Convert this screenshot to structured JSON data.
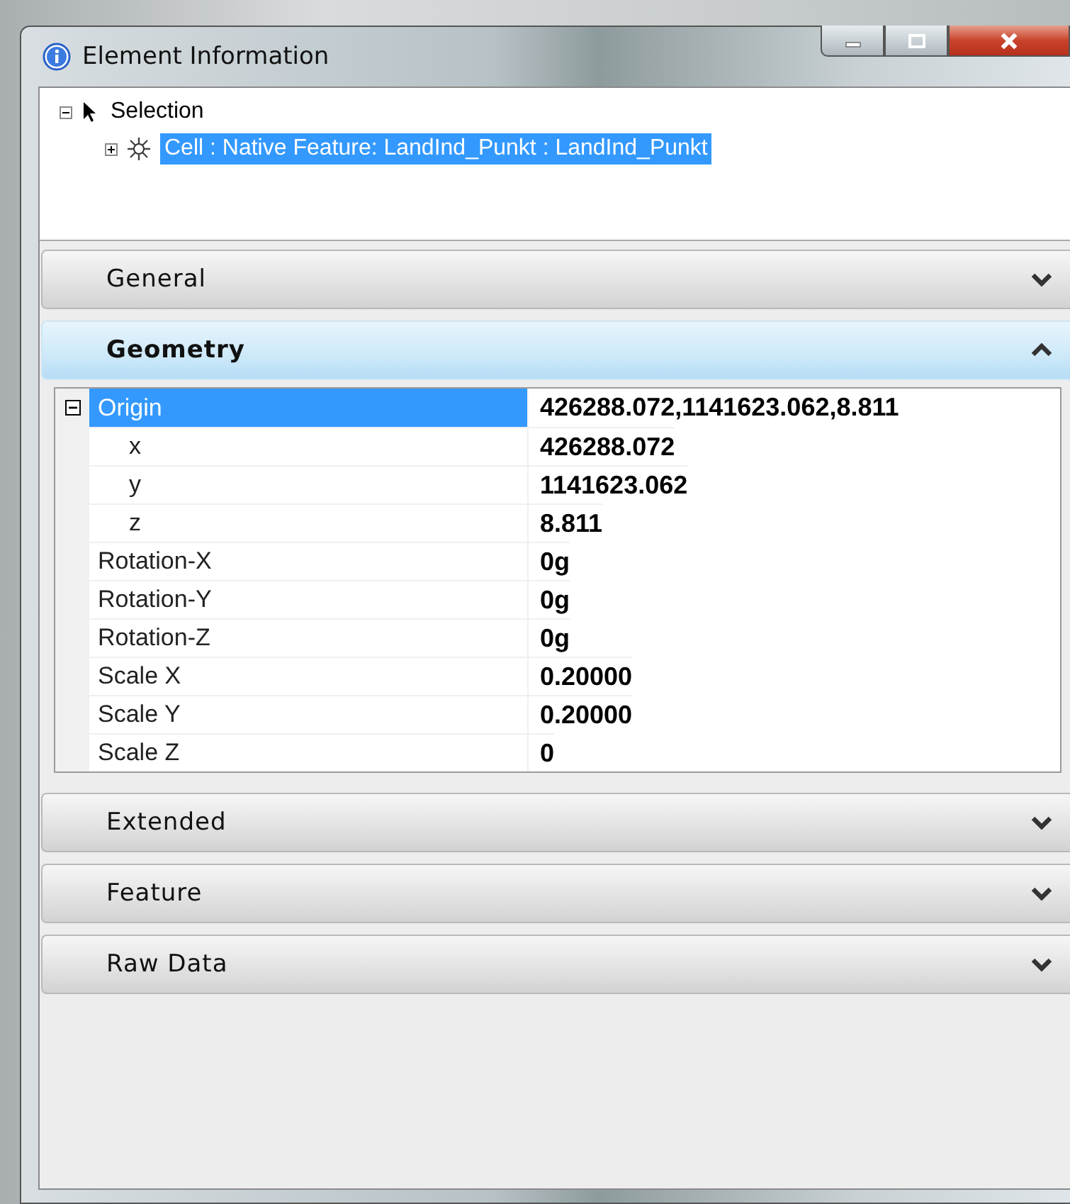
{
  "window": {
    "title": "Element Information"
  },
  "tree": [
    {
      "label": "Selection",
      "kind": "pointer",
      "expanded": true,
      "selected": false,
      "children": [
        {
          "label": "Cell : Native Feature: LandInd_Punkt : LandInd_Punkt",
          "kind": "cell",
          "expanded": false,
          "selected": true
        }
      ]
    }
  ],
  "sections": [
    {
      "title": "General",
      "expanded": false
    },
    {
      "title": "Geometry",
      "expanded": true,
      "properties": [
        {
          "name": "Origin",
          "value": "426288.072,1141623.062,8.811",
          "selected": true,
          "expanded": true,
          "children": [
            {
              "name": "x",
              "value": "426288.072",
              "selected": false
            },
            {
              "name": "y",
              "value": "1141623.062",
              "selected": false
            },
            {
              "name": "z",
              "value": "8.811",
              "selected": false
            }
          ]
        },
        {
          "name": "Rotation-X",
          "value": "0g",
          "selected": false
        },
        {
          "name": "Rotation-Y",
          "value": "0g",
          "selected": false
        },
        {
          "name": "Rotation-Z",
          "value": "0g",
          "selected": false
        },
        {
          "name": "Scale X",
          "value": "0.20000",
          "selected": false
        },
        {
          "name": "Scale Y",
          "value": "0.20000",
          "selected": false
        },
        {
          "name": "Scale Z",
          "value": "0",
          "selected": false
        }
      ]
    },
    {
      "title": "Extended",
      "expanded": false
    },
    {
      "title": "Feature",
      "expanded": false
    },
    {
      "title": "Raw Data",
      "expanded": false
    }
  ]
}
